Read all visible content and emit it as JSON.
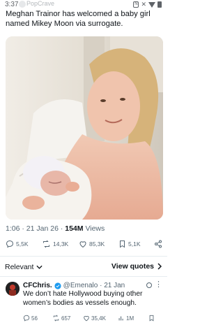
{
  "status_bar": {
    "time": "3:37",
    "ghost_name": "PopCrave"
  },
  "tweet": {
    "text": "Meghan Trainor has welcomed a baby girl named Mikey Moon via surrogate.",
    "time": "1:06",
    "date": "21 Jan 26",
    "views_count": "154M",
    "views_label": "Views",
    "sep": " · "
  },
  "actions": {
    "replies": "5,5K",
    "reposts": "14,3K",
    "likes": "85,3K",
    "bookmarks": "5,1K"
  },
  "replies_header": {
    "sort_label": "Relevant",
    "view_quotes_label": "View quotes"
  },
  "reply": {
    "name": "CFChris.",
    "handle": "@Emenalo",
    "date": "21 Jan",
    "text": "We don’t hate Hollywood buying other women’s bodies as vessels enough.",
    "replies": "56",
    "reposts": "657",
    "likes": "35,4K",
    "views": "1M"
  },
  "colors": {
    "text": "#0f1419",
    "muted": "#536471",
    "verified": "#1d9bf0"
  }
}
